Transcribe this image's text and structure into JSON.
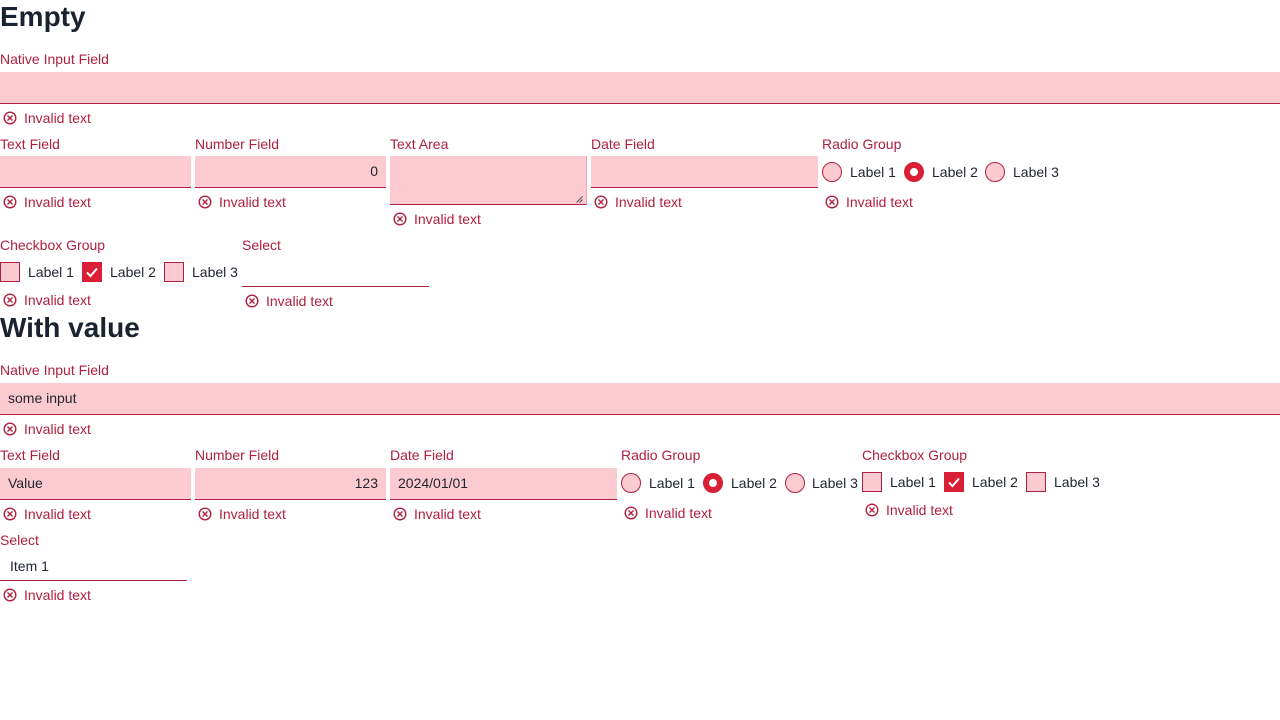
{
  "empty": {
    "title": "Empty",
    "native": {
      "label": "Native Input Field",
      "value": "",
      "error": "Invalid text"
    },
    "text_field": {
      "label": "Text Field",
      "value": "",
      "error": "Invalid text"
    },
    "number_field": {
      "label": "Number Field",
      "value": "0",
      "error": "Invalid text"
    },
    "text_area": {
      "label": "Text Area",
      "value": "",
      "error": "Invalid text"
    },
    "date_field": {
      "label": "Date Field",
      "value": "",
      "error": "Invalid text"
    },
    "radio_group": {
      "label": "Radio Group",
      "options": [
        "Label 1",
        "Label 2",
        "Label 3"
      ],
      "selected": "Label 2",
      "error": "Invalid text"
    },
    "checkbox_group": {
      "label": "Checkbox Group",
      "options": [
        "Label 1",
        "Label 2",
        "Label 3"
      ],
      "checked": [
        "Label 2"
      ],
      "error": "Invalid text"
    },
    "select": {
      "label": "Select",
      "value": "",
      "error": "Invalid text"
    }
  },
  "with_value": {
    "title": "With value",
    "native": {
      "label": "Native Input Field",
      "value": "some input",
      "error": "Invalid text"
    },
    "text_field": {
      "label": "Text Field",
      "value": "Value",
      "error": "Invalid text"
    },
    "number_field": {
      "label": "Number Field",
      "value": "123",
      "error": "Invalid text"
    },
    "date_field": {
      "label": "Date Field",
      "value": "2024/01/01",
      "error": "Invalid text"
    },
    "radio_group": {
      "label": "Radio Group",
      "options": [
        "Label 1",
        "Label 2",
        "Label 3"
      ],
      "selected": "Label 2",
      "error": "Invalid text"
    },
    "checkbox_group": {
      "label": "Checkbox Group",
      "options": [
        "Label 1",
        "Label 2",
        "Label 3"
      ],
      "checked": [
        "Label 2"
      ],
      "error": "Invalid text"
    },
    "select": {
      "label": "Select",
      "value": "Item 1",
      "error": "Invalid text"
    }
  },
  "icons": {
    "error": "error-circle-icon",
    "check": "check-icon",
    "resize": "resize-grip-icon"
  },
  "colors": {
    "error": "#b02040",
    "invalid_fill": "#fccbd1",
    "accent": "#d81f35",
    "heading": "#1c2330"
  }
}
